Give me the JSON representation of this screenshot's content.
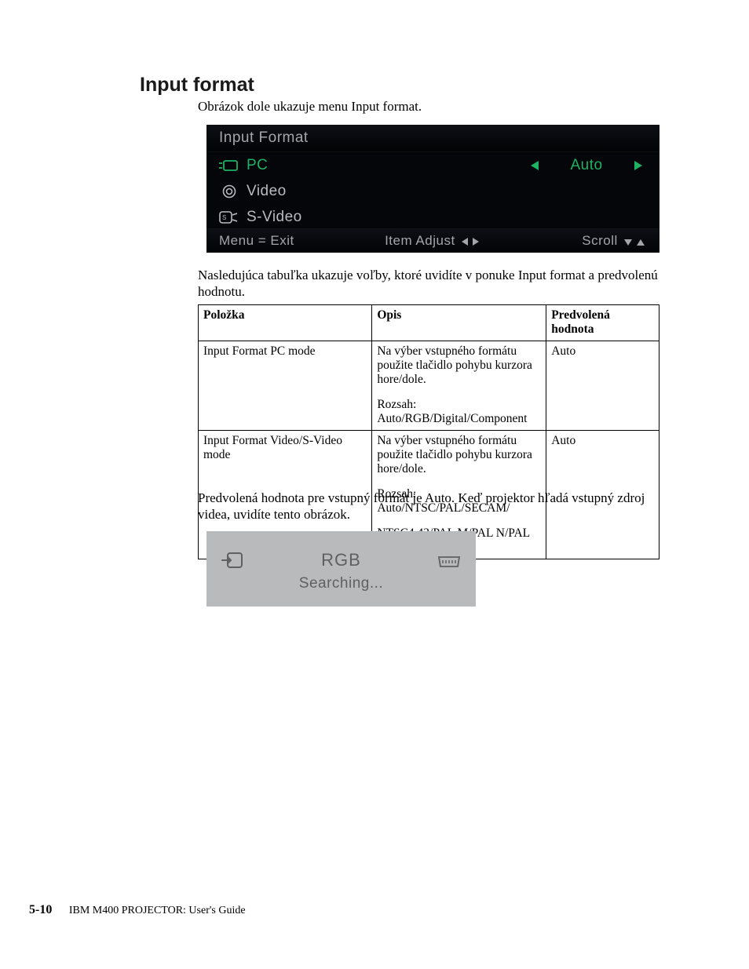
{
  "heading": "Input format",
  "intro": "Obrázok dole ukazuje menu Input format.",
  "osd": {
    "title": "Input Format",
    "items": [
      {
        "label": "PC",
        "value": "Auto",
        "selected": true
      },
      {
        "label": "Video",
        "value": "",
        "selected": false
      },
      {
        "label": "S-Video",
        "value": "",
        "selected": false
      }
    ],
    "footer": {
      "exit": "Menu = Exit",
      "adjust": "Item Adjust",
      "scroll": "Scroll"
    }
  },
  "after_osd": "Nasledujúca tabuľka ukazuje voľby, ktoré uvidíte v ponuke Input format a predvolenú hodnotu.",
  "table": {
    "headers": {
      "col1": "Položka",
      "col2": "Opis",
      "col3": "Predvolená hodnota"
    },
    "rows": [
      {
        "item": "Input Format PC mode",
        "desc1": "Na výber vstupného formátu použite tlačidlo pohybu kurzora hore/dole.",
        "desc2": "Rozsah: Auto/RGB/Digital/Component",
        "default": "Auto"
      },
      {
        "item": "Input Format Video/S-Video mode",
        "desc1": "Na výber vstupného formátu použite tlačidlo pohybu kurzora hore/dole.",
        "desc2": "Rozsah: Auto/NTSC/PAL/SECAM/",
        "desc3": "NTSC4.43/PAL M/PAL N/PAL 60",
        "default": "Auto"
      }
    ]
  },
  "after_table": "Predvolená hodnota pre vstupný formát je Auto. Keď projektor hľadá vstupný zdroj videa, uvidíte tento obrázok.",
  "search_box": {
    "line1": "RGB",
    "line2": "Searching..."
  },
  "footer": {
    "page_num": "5-10",
    "book": "IBM M400 PROJECTOR: User's Guide"
  }
}
